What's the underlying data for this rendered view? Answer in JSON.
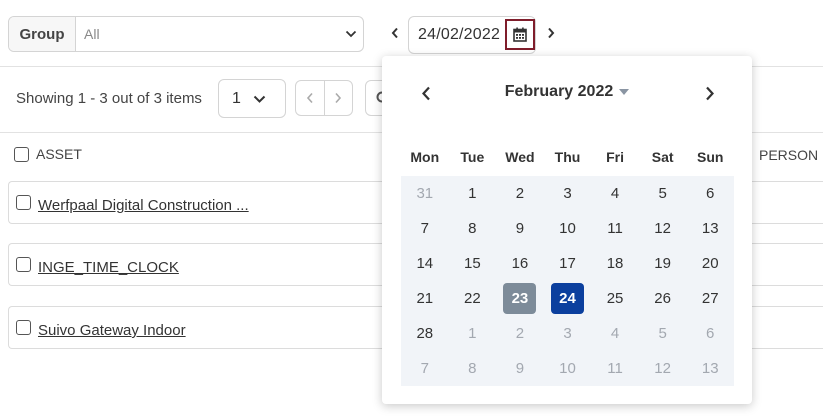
{
  "filter": {
    "group_label": "Group",
    "group_value": "All",
    "date_value": "24/02/2022"
  },
  "pagination": {
    "showing_text": "Showing 1 - 3 out of 3 items",
    "page_size": "1"
  },
  "table": {
    "col_asset": "ASSET",
    "col_person": "PERSON",
    "rows": [
      {
        "asset": "Werfpaal Digital Construction ..."
      },
      {
        "asset": "INGE_TIME_CLOCK"
      },
      {
        "asset": "Suivo Gateway Indoor"
      }
    ]
  },
  "calendar": {
    "month_title": "February 2022",
    "weekdays": [
      "Mon",
      "Tue",
      "Wed",
      "Thu",
      "Fri",
      "Sat",
      "Sun"
    ],
    "weeks": [
      [
        "31",
        "1",
        "2",
        "3",
        "4",
        "5",
        "6"
      ],
      [
        "7",
        "8",
        "9",
        "10",
        "11",
        "12",
        "13"
      ],
      [
        "14",
        "15",
        "16",
        "17",
        "18",
        "19",
        "20"
      ],
      [
        "21",
        "22",
        "23",
        "24",
        "25",
        "26",
        "27"
      ],
      [
        "28",
        "1",
        "2",
        "3",
        "4",
        "5",
        "6"
      ],
      [
        "7",
        "8",
        "9",
        "10",
        "11",
        "12",
        "13"
      ]
    ],
    "selected_day": "24",
    "highlighted_day": "23",
    "colors": {
      "selected": "#0b3f9e",
      "highlighted": "#7d8b99",
      "outside_month": "#a3a8b0",
      "focus_border": "#7f1d2b"
    }
  }
}
